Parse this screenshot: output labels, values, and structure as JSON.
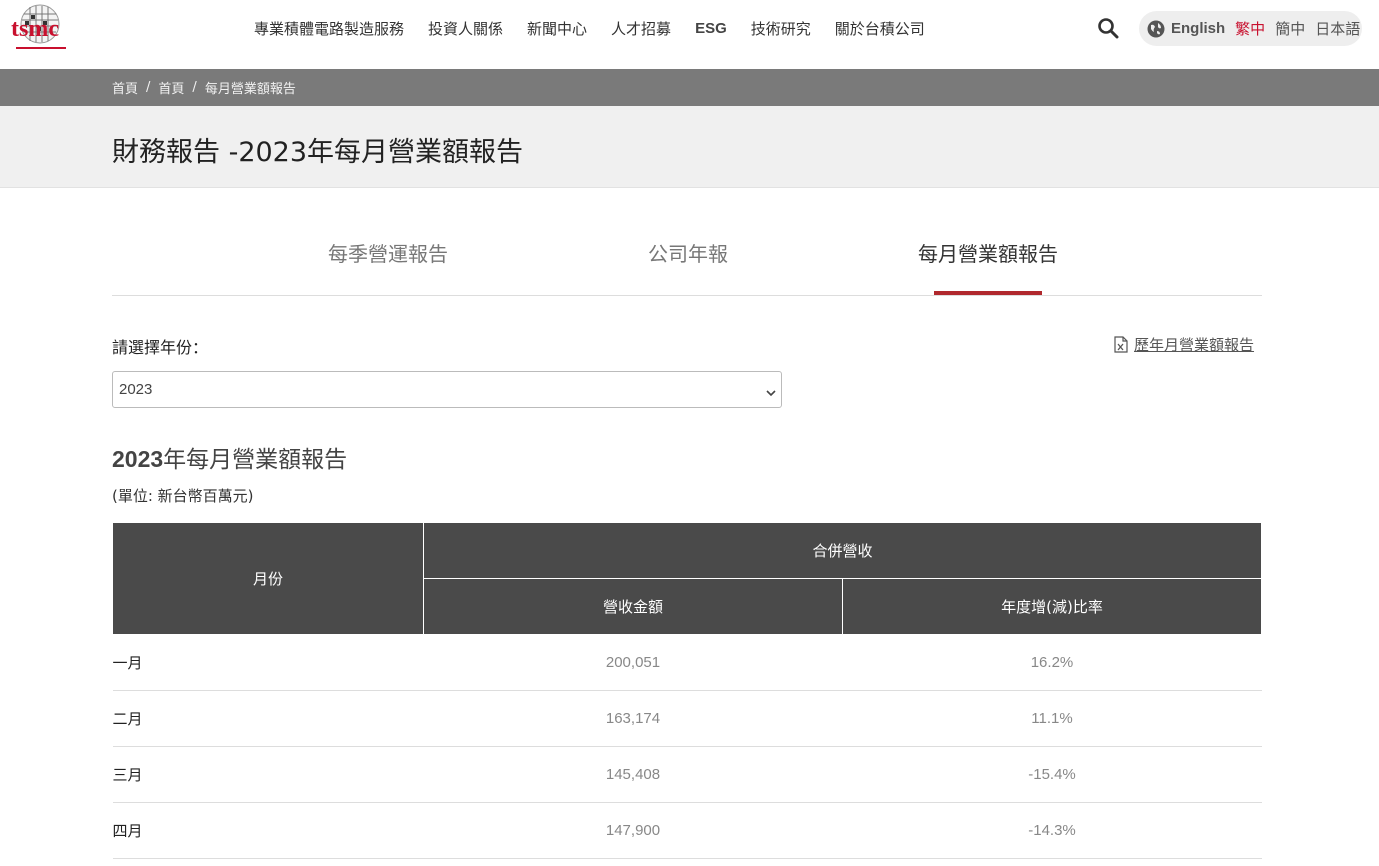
{
  "header": {
    "logo_text": "tsmc",
    "nav": [
      "專業積體電路製造服務",
      "投資人關係",
      "新聞中心",
      "人才招募",
      "ESG",
      "技術研究",
      "關於台積公司"
    ],
    "languages": [
      {
        "label": "English",
        "active": false
      },
      {
        "label": "繁中",
        "active": true
      },
      {
        "label": "簡中",
        "active": false
      },
      {
        "label": "日本語",
        "active": false
      }
    ],
    "accent_color": "#c8102e"
  },
  "breadcrumb": [
    "首頁",
    "首頁",
    "每月營業額報告"
  ],
  "page_title": "財務報告 -2023年每月營業額報告",
  "tabs": [
    {
      "label": "每季營運報告",
      "active": false
    },
    {
      "label": "公司年報",
      "active": false
    },
    {
      "label": "每月營業額報告",
      "active": true
    }
  ],
  "filter": {
    "label": "請選擇年份：",
    "selected_year": "2023",
    "history_link": "歷年月營業額報告"
  },
  "section": {
    "title_year": "2023",
    "title_rest": "年每月營業額報告",
    "unit_note": "(單位: 新台幣百萬元)"
  },
  "table": {
    "headers": {
      "month": "月份",
      "group": "合併營收",
      "revenue": "營收金額",
      "yoy": "年度增(減)比率"
    },
    "rows": [
      {
        "month": "一月",
        "revenue": "200,051",
        "yoy": "16.2%"
      },
      {
        "month": "二月",
        "revenue": "163,174",
        "yoy": "11.1%"
      },
      {
        "month": "三月",
        "revenue": "145,408",
        "yoy": "-15.4%"
      },
      {
        "month": "四月",
        "revenue": "147,900",
        "yoy": "-14.3%"
      }
    ]
  }
}
